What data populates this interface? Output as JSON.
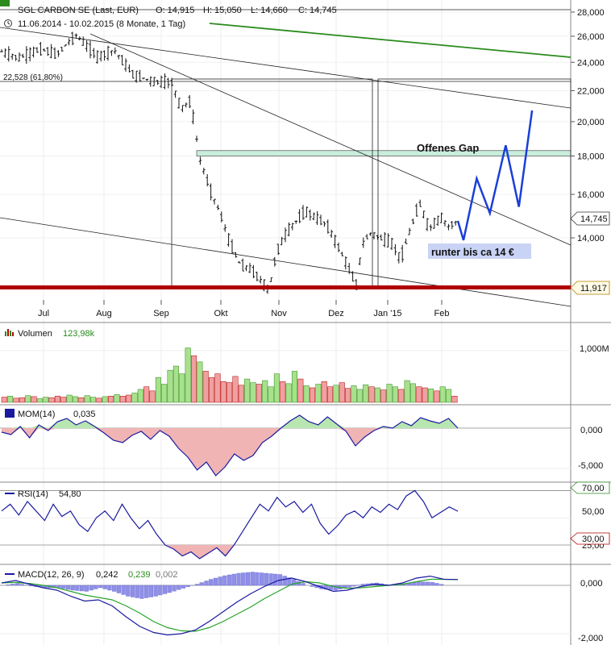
{
  "header": {
    "title": "SGL CARBON SE (Last, EUR)",
    "open": "O: 14,915",
    "high": "H: 15,050",
    "low": "L: 14,660",
    "close": "C: 14,745",
    "range": "11.06.2014 - 10.02.2015 (8 Monate, 1 Tag)",
    "fib_label": "22,528 (61,80%)"
  },
  "annotations": {
    "gap": "Offenes Gap",
    "target": "runter bis ca 14 €",
    "last_price": "14,745",
    "support_price": "11,917"
  },
  "colors": {
    "projection": "#1a3fd8",
    "support": "#b00000",
    "trend_green": "#2a8a1c",
    "gap_zone": "#c8eedb",
    "vol_up": "#a8e08c",
    "vol_down": "#f0a0a0",
    "indicator_line": "#1a1aa0",
    "signal_line": "#27a52a"
  },
  "chart_data": [
    {
      "type": "line",
      "title": "SGL CARBON SE (Last, EUR)",
      "x_tick_labels": [
        "Jul",
        "Aug",
        "Sep",
        "Okt",
        "Nov",
        "Dez",
        "Jan '15",
        "Feb"
      ],
      "y_tick_labels": [
        "28,000",
        "26,000",
        "24,000",
        "22,000",
        "20,000",
        "18,000",
        "16,000",
        "14,000"
      ],
      "ylim": [
        11.0,
        28.5
      ],
      "log_scale": true,
      "series": [
        {
          "x": [
            "Jun 11",
            "Jun 20",
            "Jul 1",
            "Jul 10",
            "Jul 20",
            "Aug 1",
            "Aug 10",
            "Aug 20",
            "Sep 1",
            "Sep 10",
            "Sep 15",
            "Sep 20",
            "Sep 25",
            "Oct 1",
            "Oct 5",
            "Oct 10",
            "Oct 16",
            "Oct 22",
            "Nov 1",
            "Nov 5",
            "Nov 10",
            "Nov 20",
            "Dec 1",
            "Dec 10",
            "Dec 17",
            "Dec 20",
            "Dec 24",
            "Jan 5",
            "Jan 10",
            "Jan 15",
            "Jan 20",
            "Jan 25",
            "Feb 1",
            "Feb 5",
            "Feb 10"
          ],
          "y": [
            24.8,
            24.3,
            25.0,
            24.6,
            26.1,
            24.4,
            24.9,
            23.1,
            22.6,
            22.6,
            20.8,
            21.3,
            17.8,
            16.0,
            15.2,
            13.9,
            12.9,
            12.7,
            11.9,
            13.4,
            14.2,
            15.2,
            14.6,
            13.2,
            12.1,
            13.7,
            14.2,
            13.8,
            13.1,
            14.3,
            15.6,
            14.4,
            14.9,
            14.5,
            14.75
          ]
        }
      ],
      "annotations": [
        "22,528 (61,80%)",
        "Offenes Gap",
        "runter bis ca 14 €",
        "14,745",
        "11,917"
      ],
      "horizontal_levels": [
        22.528,
        11.917
      ],
      "gap_zone": [
        18.0,
        18.3
      ],
      "projection": {
        "x": [
          "Feb 10",
          "Feb 13",
          "Feb 20",
          "Feb 27",
          "Mar 5",
          "Mar 12",
          "Mar 19"
        ],
        "y": [
          14.75,
          13.9,
          16.8,
          15.1,
          18.6,
          15.4,
          20.7
        ]
      }
    },
    {
      "type": "bar",
      "title": "Volumen",
      "value_label": "123,98k",
      "y_tick_labels": [
        "1,000M"
      ],
      "ylim": [
        0,
        1.4
      ],
      "values": [
        0.1,
        0.12,
        0.08,
        0.09,
        0.13,
        0.11,
        0.07,
        0.1,
        0.09,
        0.12,
        0.1,
        0.14,
        0.11,
        0.09,
        0.13,
        0.1,
        0.08,
        0.11,
        0.12,
        0.15,
        0.12,
        0.14,
        0.18,
        0.25,
        0.3,
        0.22,
        0.48,
        0.35,
        0.62,
        0.7,
        0.55,
        1.05,
        0.9,
        0.78,
        0.6,
        0.48,
        0.55,
        0.4,
        0.38,
        0.5,
        0.33,
        0.45,
        0.38,
        0.35,
        0.42,
        0.3,
        0.55,
        0.4,
        0.36,
        0.6,
        0.45,
        0.32,
        0.28,
        0.35,
        0.4,
        0.3,
        0.33,
        0.38,
        0.27,
        0.32,
        0.25,
        0.34,
        0.3,
        0.28,
        0.24,
        0.35,
        0.3,
        0.25,
        0.42,
        0.36,
        0.3,
        0.28,
        0.26,
        0.22,
        0.3,
        0.25,
        0.12
      ]
    },
    {
      "type": "area",
      "title": "MOM(14)",
      "value_label": "0,035",
      "y_tick_labels": [
        "0,000",
        "-5,000"
      ],
      "ylim": [
        -6.5,
        2.5
      ],
      "values": [
        -0.5,
        -0.8,
        0.2,
        -1.2,
        0.4,
        -0.3,
        0.8,
        1.2,
        0.4,
        0.9,
        0.2,
        -0.6,
        -1.5,
        -1.8,
        -0.9,
        -0.4,
        -1.4,
        -0.3,
        -1.0,
        -2.5,
        -3.6,
        -5.2,
        -4.2,
        -5.9,
        -4.8,
        -3.2,
        -4.0,
        -3.4,
        -1.8,
        -1.0,
        0.0,
        0.9,
        1.6,
        0.8,
        0.4,
        1.4,
        0.5,
        -0.4,
        -2.2,
        -1.1,
        -0.3,
        0.2,
        0.0,
        0.8,
        0.3,
        1.3,
        0.9,
        0.6,
        1.2,
        0.0
      ]
    },
    {
      "type": "line",
      "title": "RSI(14)",
      "value_label": "54,80",
      "y_tick_labels": [
        "70,00",
        "50,00",
        "30,00",
        "25,00"
      ],
      "ylim": [
        17,
        75
      ],
      "levels": [
        70,
        30
      ],
      "values": [
        55,
        60,
        52,
        62,
        55,
        48,
        60,
        51,
        55,
        45,
        40,
        50,
        55,
        48,
        60,
        50,
        42,
        48,
        38,
        30,
        27,
        22,
        25,
        20,
        24,
        28,
        22,
        30,
        40,
        50,
        60,
        55,
        65,
        58,
        62,
        54,
        60,
        46,
        38,
        44,
        52,
        55,
        50,
        58,
        54,
        60,
        56,
        66,
        70,
        62,
        50,
        54,
        58,
        54.8
      ]
    },
    {
      "type": "line",
      "title": "MACD(12, 26, 9)",
      "value_label": "0,242",
      "signal_label": "0,239",
      "hist_label": "0,002",
      "y_tick_labels": [
        "0,000",
        "-2,000"
      ],
      "ylim": [
        -2.4,
        0.8
      ],
      "series": [
        {
          "name": "MACD(12, 26, 9)",
          "values": [
            0.1,
            0.2,
            0.05,
            -0.1,
            -0.2,
            -0.45,
            -0.65,
            -0.6,
            -0.85,
            -1.3,
            -1.7,
            -1.95,
            -2.05,
            -2.0,
            -1.85,
            -1.5,
            -1.1,
            -0.7,
            -0.35,
            -0.05,
            0.2,
            0.3,
            0.15,
            -0.05,
            -0.25,
            -0.2,
            -0.05,
            0.05,
            0.0,
            0.1,
            0.3,
            0.38,
            0.25,
            0.24
          ]
        },
        {
          "name": "Signal",
          "values": [
            0.1,
            0.12,
            0.08,
            0.0,
            -0.1,
            -0.25,
            -0.4,
            -0.5,
            -0.6,
            -0.85,
            -1.15,
            -1.5,
            -1.75,
            -1.88,
            -1.9,
            -1.75,
            -1.5,
            -1.2,
            -0.9,
            -0.55,
            -0.25,
            0.05,
            0.15,
            0.1,
            -0.05,
            -0.12,
            -0.1,
            -0.05,
            0.0,
            0.05,
            0.15,
            0.25,
            0.25,
            0.24
          ]
        }
      ],
      "histogram": [
        0.0,
        0.08,
        -0.03,
        -0.1,
        -0.1,
        -0.2,
        -0.25,
        -0.1,
        -0.25,
        -0.45,
        -0.55,
        -0.45,
        -0.3,
        -0.12,
        0.05,
        0.25,
        0.4,
        0.5,
        0.55,
        0.5,
        0.45,
        0.25,
        0.0,
        -0.15,
        -0.2,
        -0.08,
        0.05,
        0.1,
        0.0,
        0.05,
        0.15,
        0.13,
        0.0,
        0.0
      ]
    }
  ]
}
